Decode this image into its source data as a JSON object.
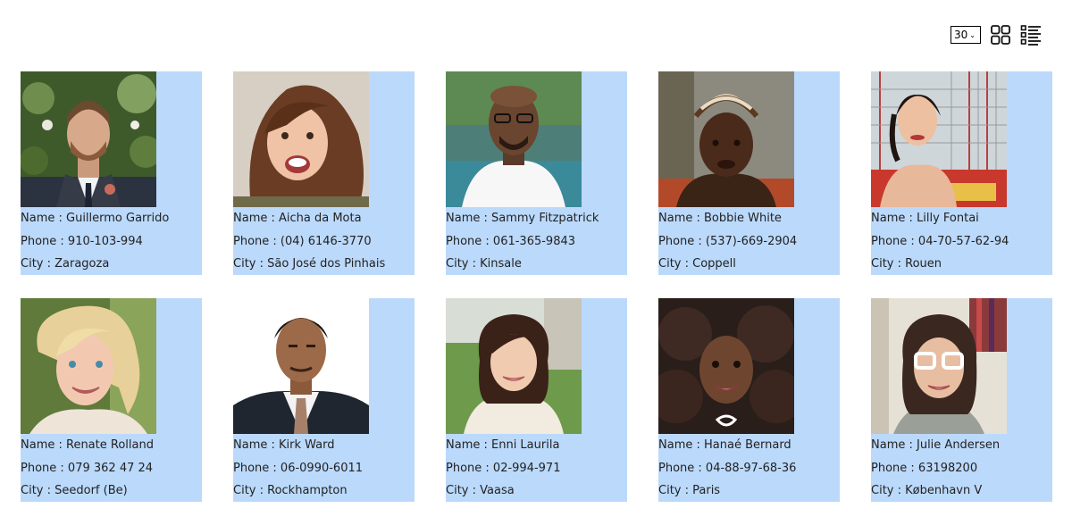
{
  "toolbar": {
    "page_size": "30",
    "colors": {
      "icon": "#111111",
      "border": "#000000"
    },
    "grid_icon": "grid-view-icon",
    "list_icon": "list-view-icon"
  },
  "labels": {
    "name": "Name : ",
    "phone": "Phone : ",
    "city": "City : "
  },
  "card_color": "#bbd9fb",
  "people": [
    {
      "name": "Guillermo Garrido",
      "phone": "910-103-994",
      "city": "Zaragoza"
    },
    {
      "name": "Aicha da Mota",
      "phone": "(04) 6146-3770",
      "city": "São José dos Pinhais"
    },
    {
      "name": "Sammy Fitzpatrick",
      "phone": "061-365-9843",
      "city": "Kinsale"
    },
    {
      "name": "Bobbie White",
      "phone": "(537)-669-2904",
      "city": "Coppell"
    },
    {
      "name": "Lilly Fontai",
      "phone": "04-70-57-62-94",
      "city": "Rouen"
    },
    {
      "name": "Renate Rolland",
      "phone": "079 362 47 24",
      "city": "Seedorf (Be)"
    },
    {
      "name": "Kirk Ward",
      "phone": "06-0990-6011",
      "city": "Rockhampton"
    },
    {
      "name": "Enni Laurila",
      "phone": "02-994-971",
      "city": "Vaasa"
    },
    {
      "name": "Hanaé Bernard",
      "phone": "04-88-97-68-36",
      "city": "Paris"
    },
    {
      "name": "Julie Andersen",
      "phone": "63198200",
      "city": "København V"
    }
  ]
}
